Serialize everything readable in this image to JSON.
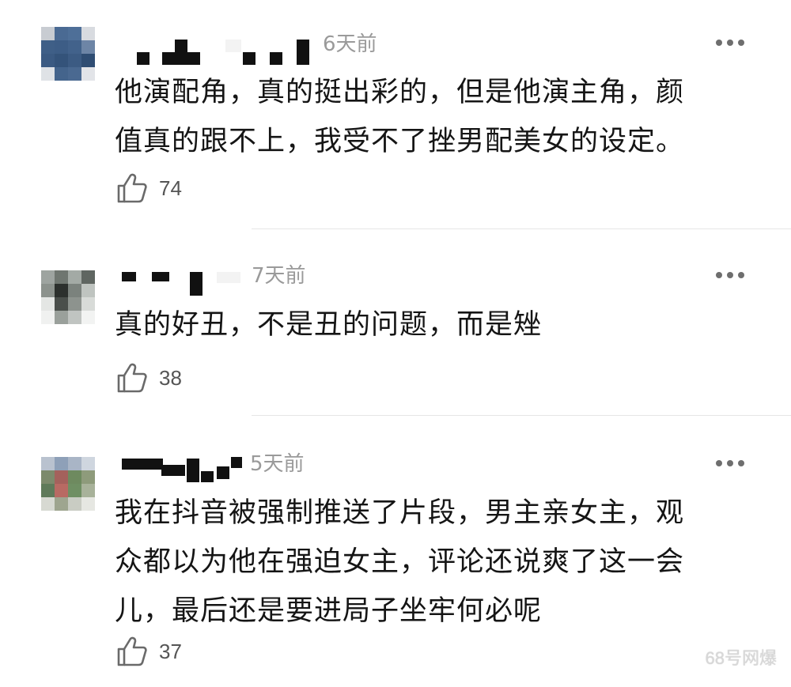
{
  "comments": [
    {
      "time": "6天前",
      "text_lines": [
        "他演配角，真的挺出彩的，但是他演主角，颜",
        "值真的跟不上，我受不了挫男配美女的设定。"
      ],
      "likes": "74"
    },
    {
      "time": "7天前",
      "text_lines": [
        "真的好丑，不是丑的问题，而是矬"
      ],
      "likes": "38"
    },
    {
      "time": "5天前",
      "text_lines": [
        "我在抖音被强制推送了片段，男主亲女主，观",
        "众都以为他在强迫女主，评论还说爽了这一会",
        "儿，最后还是要进局子坐牢何必呢"
      ],
      "likes": "37"
    }
  ],
  "watermark": "68号网爆",
  "icons": {
    "like": "thumb-up-icon",
    "more": "more-dots-icon"
  },
  "colors": {
    "text": "#151515",
    "meta": "#9a9a9a",
    "icon": "#6e6e6e"
  }
}
